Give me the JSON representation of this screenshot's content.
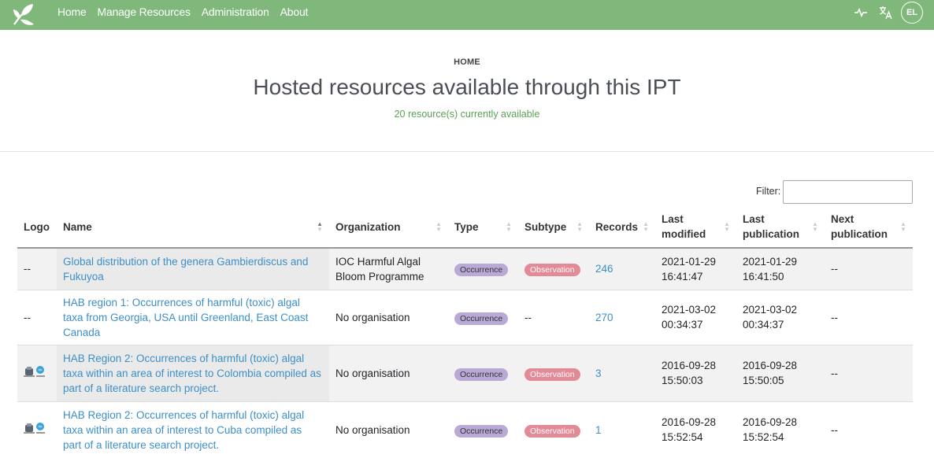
{
  "nav": {
    "links": [
      "Home",
      "Manage Resources",
      "Administration",
      "About"
    ],
    "avatar": "EL",
    "icons": [
      "leaf-logo-icon",
      "health-icon",
      "language-icon"
    ]
  },
  "header": {
    "breadcrumb": "HOME",
    "title": "Hosted resources available through this IPT",
    "subtitle": "20 resource(s) currently available"
  },
  "filter": {
    "label": "Filter:",
    "value": ""
  },
  "table": {
    "columns": [
      "Logo",
      "Name",
      "Organization",
      "Type",
      "Subtype",
      "Records",
      "Last modified",
      "Last publication",
      "Next publication"
    ],
    "rows": [
      {
        "logo": "--",
        "name": "Global distribution of the genera Gambierdiscus and Fukuyoa",
        "organization": "IOC Harmful Algal Bloom Programme",
        "type": "Occurrence",
        "subtype": "Observation",
        "records": "246",
        "last_modified": "2021-01-29 16:41:47",
        "last_publication": "2021-01-29 16:41:50",
        "next_publication": "--"
      },
      {
        "logo": "--",
        "name": "HAB region 1: Occurrences of harmful (toxic) algal taxa from Georgia, USA until Greenland, East Coast Canada",
        "organization": "No organisation",
        "type": "Occurrence",
        "subtype": "--",
        "records": "270",
        "last_modified": "2021-03-02 00:34:37",
        "last_publication": "2021-03-02 00:34:37",
        "next_publication": "--"
      },
      {
        "logo": "",
        "name": "HAB Region 2: Occurrences of harmful (toxic) algal taxa within an area of interest to Colombia compiled as part of a literature search project.",
        "organization": "No organisation",
        "type": "Occurrence",
        "subtype": "Observation",
        "records": "3",
        "last_modified": "2016-09-28 15:50:03",
        "last_publication": "2016-09-28 15:50:05",
        "next_publication": "--"
      },
      {
        "logo": "",
        "name": "HAB Region 2: Occurrences of harmful (toxic) algal taxa within an area of interest to Cuba compiled as part of a literature search project.",
        "organization": "No organisation",
        "type": "Occurrence",
        "subtype": "Observation",
        "records": "1",
        "last_modified": "2016-09-28 15:52:54",
        "last_publication": "2016-09-28 15:52:54",
        "next_publication": "--"
      }
    ]
  }
}
